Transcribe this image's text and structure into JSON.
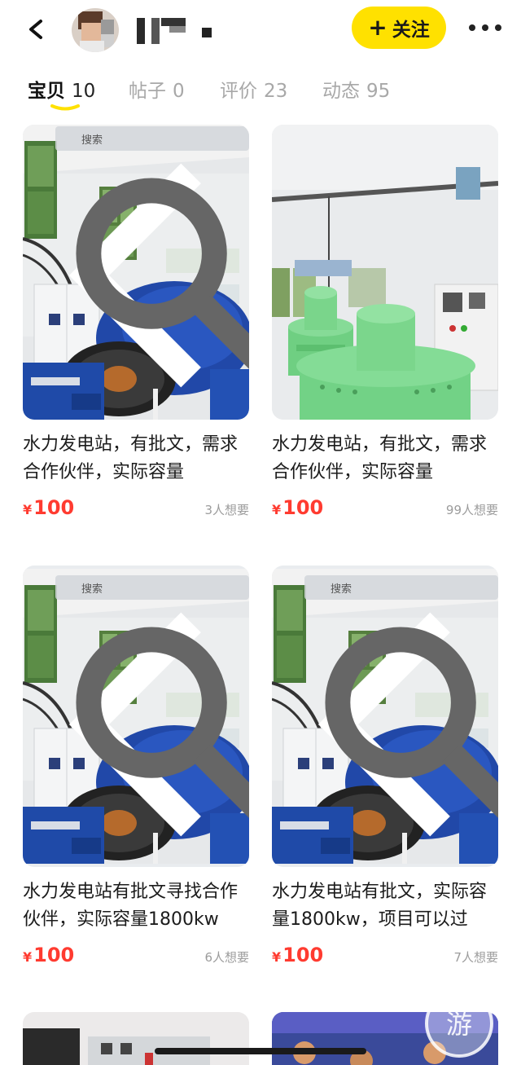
{
  "header": {
    "follow_label": "关注",
    "follow_icon": "plus-icon",
    "more_icon": "more-dots-icon",
    "back_icon": "back-chevron-icon",
    "accent_color": "#ffe100"
  },
  "tabs": [
    {
      "label": "宝贝",
      "count": "10",
      "active": true
    },
    {
      "label": "帖子",
      "count": "0",
      "active": false
    },
    {
      "label": "评价",
      "count": "23",
      "active": false
    },
    {
      "label": "动态",
      "count": "95",
      "active": false
    }
  ],
  "photo_overlay": {
    "search_label": "搜索"
  },
  "items": [
    {
      "title": "水力发电站，有批文，需求合作伙伴，实际容量",
      "currency": "¥",
      "price": "100",
      "want": "3人想要"
    },
    {
      "title": "水力发电站，有批文，需求合作伙伴，实际容量",
      "currency": "¥",
      "price": "100",
      "want": "99人想要"
    },
    {
      "title": "水力发电站有批文寻找合作伙伴，实际容量1800kw",
      "currency": "¥",
      "price": "100",
      "want": "6人想要"
    },
    {
      "title": "水力发电站有批文，实际容量1800kw，项目可以过",
      "currency": "¥",
      "price": "100",
      "want": "7人想要"
    }
  ],
  "watermark": {
    "text": "游"
  },
  "colors": {
    "price": "#ff3b30",
    "want": "#9c9c9c",
    "tab_inactive": "#a8a8a8"
  }
}
